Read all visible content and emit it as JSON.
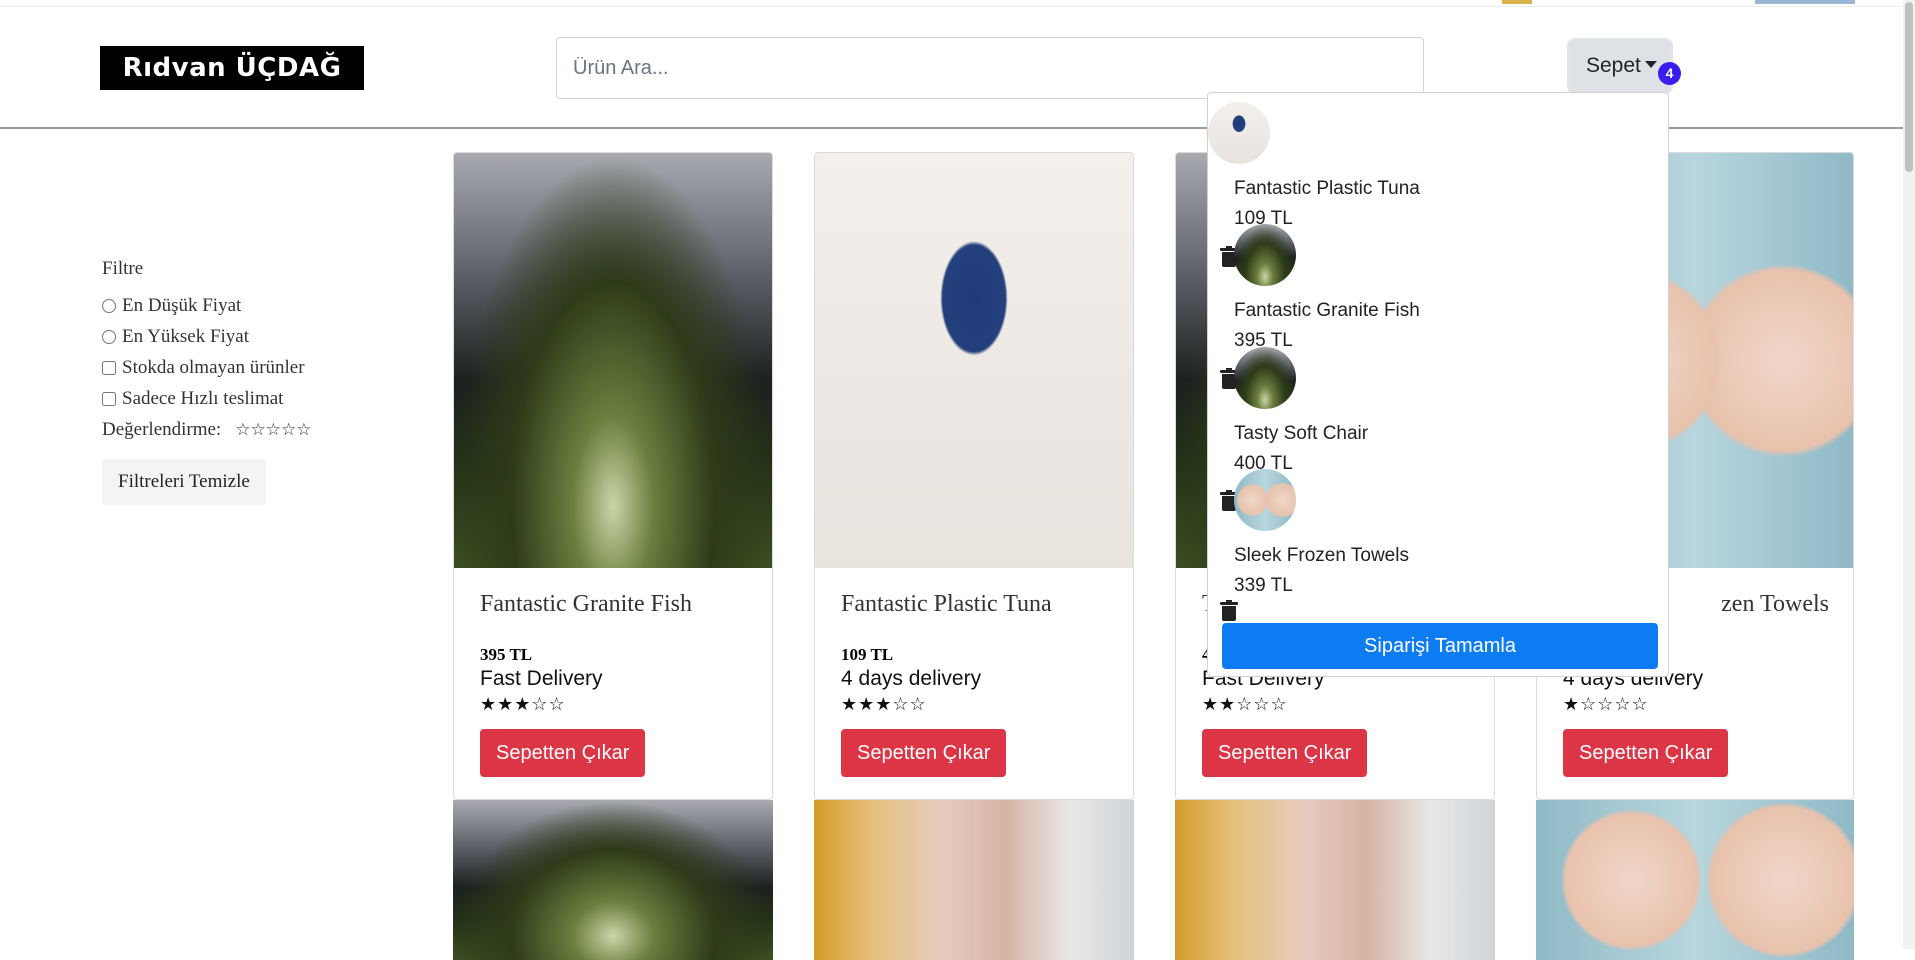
{
  "brand": {
    "logo": "Rıdvan ÜÇDAĞ"
  },
  "search": {
    "placeholder": "Ürün Ara..."
  },
  "cart": {
    "label": "Sepet",
    "count": "4"
  },
  "filters": {
    "title": "Filtre",
    "lowest_price": "En Düşük Fiyat",
    "highest_price": "En Yüksek Fiyat",
    "out_of_stock": "Stokda olmayan ürünler",
    "fast_delivery_only": "Sadece Hızlı teslimat",
    "rating_label": "Değerlendirme:",
    "rating_stars": "☆☆☆☆☆",
    "clear": "Filtreleri Temizle"
  },
  "products": [
    {
      "title": "Fantastic Granite Fish",
      "price": "395 TL",
      "delivery": "Fast Delivery",
      "rating": 3,
      "stars": "★★★☆☆",
      "button": "Sepetten Çıkar",
      "image": "golf"
    },
    {
      "title": "Fantastic Plastic Tuna",
      "price": "109 TL",
      "delivery": "4 days delivery",
      "rating": 3,
      "stars": "★★★☆☆",
      "button": "Sepetten Çıkar",
      "image": "jump"
    },
    {
      "title": "T",
      "price": "4",
      "delivery": "Fast Delivery",
      "rating": 2,
      "stars": "★★☆☆☆",
      "button": "Sepetten Çıkar",
      "image": "golf"
    },
    {
      "title": "zen Towels",
      "price": "",
      "delivery": "4 days delivery",
      "rating": 1,
      "stars": "★☆☆☆☆",
      "button": "Sepetten Çıkar",
      "image": "face"
    }
  ],
  "cart_dropdown": {
    "items": [
      {
        "name": "Fantastic Plastic Tuna",
        "price": "109 TL",
        "image": "jump"
      },
      {
        "name": "Fantastic Granite Fish",
        "price": "395 TL",
        "image": "golf"
      },
      {
        "name": "Tasty Soft Chair",
        "price": "400 TL",
        "image": "golf"
      },
      {
        "name": "Sleek Frozen Towels",
        "price": "339 TL",
        "image": "face"
      }
    ],
    "complete": "Siparişi Tamamla"
  }
}
